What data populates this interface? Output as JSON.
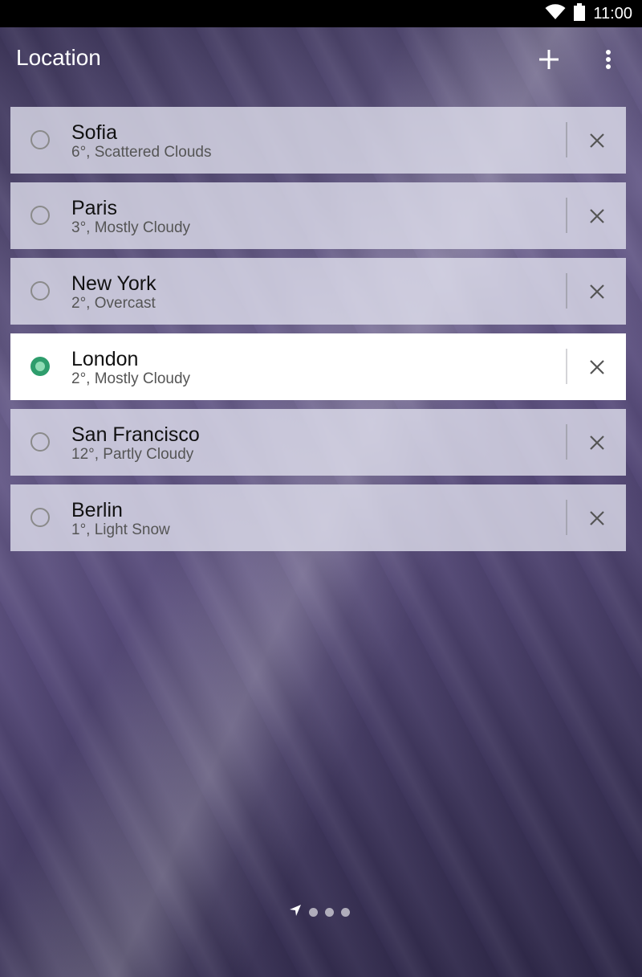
{
  "status_bar": {
    "time": "11:00",
    "icons": [
      "wifi-icon",
      "battery-icon"
    ]
  },
  "app_bar": {
    "title": "Location",
    "actions": [
      "add-icon",
      "overflow-menu-icon"
    ]
  },
  "colors": {
    "accent": "#2e9d6c",
    "accent_light": "#8fdcb4",
    "title_text": "#ffffff"
  },
  "locations": [
    {
      "city": "Sofia",
      "weather": "6°, Scattered Clouds",
      "selected": false
    },
    {
      "city": "Paris",
      "weather": "3°, Mostly Cloudy",
      "selected": false
    },
    {
      "city": "New York",
      "weather": "2°, Overcast",
      "selected": false
    },
    {
      "city": "London",
      "weather": "2°, Mostly Cloudy",
      "selected": true
    },
    {
      "city": "San Francisco",
      "weather": "12°, Partly Cloudy",
      "selected": false
    },
    {
      "city": "Berlin",
      "weather": "1°, Light Snow",
      "selected": false
    }
  ],
  "pager": {
    "first_indicator": "location-arrow-icon",
    "total_pages": 4,
    "current_page": 1
  }
}
